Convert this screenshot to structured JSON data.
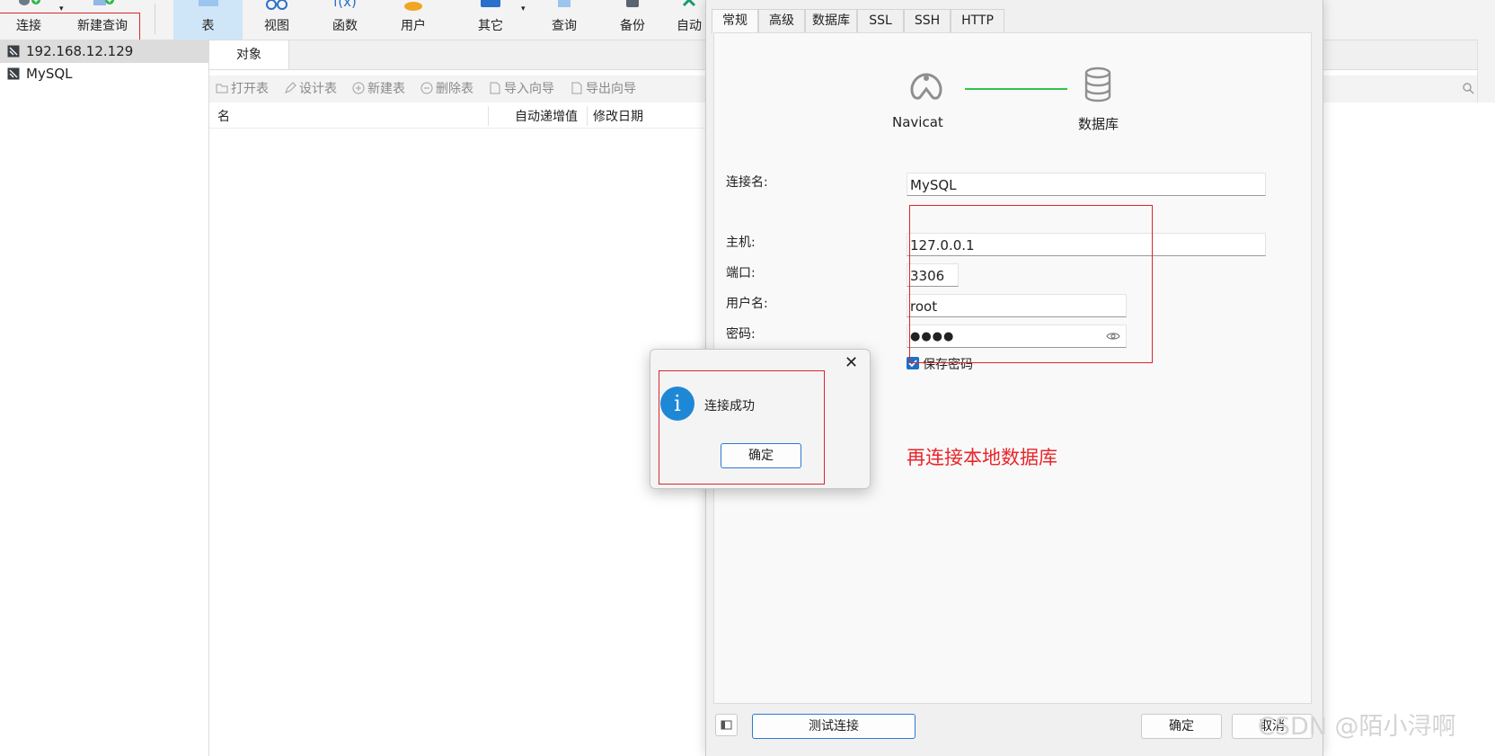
{
  "toolbar": {
    "connect": "连接",
    "new_query": "新建查询",
    "table": "表",
    "view": "视图",
    "function": "函数",
    "user": "用户",
    "other": "其它",
    "query": "查询",
    "backup": "备份",
    "automation": "自动"
  },
  "tree": {
    "items": [
      {
        "label": "192.168.12.129"
      },
      {
        "label": "MySQL"
      }
    ]
  },
  "main": {
    "tab_label": "对象",
    "object_toolbar": {
      "open_table": "打开表",
      "design_table": "设计表",
      "new_table": "新建表",
      "delete_table": "删除表",
      "import_wizard": "导入向导",
      "export_wizard": "导出向导"
    },
    "columns": [
      "名",
      "自动递增值",
      "修改日期"
    ]
  },
  "dialog": {
    "tabs": [
      "常规",
      "高级",
      "数据库",
      "SSL",
      "SSH",
      "HTTP"
    ],
    "diagram": {
      "left_label": "Navicat",
      "right_label": "数据库"
    },
    "fields": {
      "connection_name": {
        "label": "连接名:",
        "value": "MySQL"
      },
      "host": {
        "label": "主机:",
        "value": "127.0.0.1"
      },
      "port": {
        "label": "端口:",
        "value": "3306"
      },
      "username": {
        "label": "用户名:",
        "value": "root"
      },
      "password": {
        "label": "密码:",
        "value": "●●●●"
      }
    },
    "save_password": {
      "label": "保存密码",
      "checked": true
    },
    "annotation": "再连接本地数据库",
    "buttons": {
      "test": "测试连接",
      "ok": "确定",
      "cancel": "取消"
    }
  },
  "popup": {
    "message": "连接成功",
    "ok": "确定",
    "close_glyph": "✕",
    "info_glyph": "i"
  },
  "watermark": "CSDN @陌小浔啊",
  "colors": {
    "accent": "#1e88d6",
    "annotation_red": "#e8262b",
    "link_line": "#33c24d"
  }
}
